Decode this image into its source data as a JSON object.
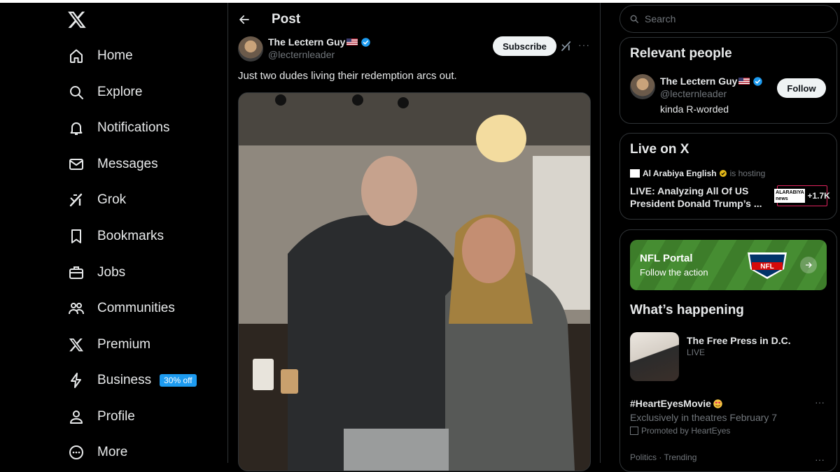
{
  "nav": {
    "items": [
      {
        "label": "Home",
        "icon": "home-icon"
      },
      {
        "label": "Explore",
        "icon": "search-icon"
      },
      {
        "label": "Notifications",
        "icon": "bell-icon"
      },
      {
        "label": "Messages",
        "icon": "envelope-icon"
      },
      {
        "label": "Grok",
        "icon": "grok-icon"
      },
      {
        "label": "Bookmarks",
        "icon": "bookmark-icon"
      },
      {
        "label": "Jobs",
        "icon": "briefcase-icon"
      },
      {
        "label": "Communities",
        "icon": "people-icon"
      },
      {
        "label": "Premium",
        "icon": "x-logo-icon"
      },
      {
        "label": "Business",
        "icon": "lightning-icon",
        "badge": "30% off"
      },
      {
        "label": "Profile",
        "icon": "person-icon"
      },
      {
        "label": "More",
        "icon": "more-circle-icon"
      }
    ]
  },
  "post": {
    "header_title": "Post",
    "author_name": "The Lectern Guy",
    "author_handle": "@lecternleader",
    "subscribe_label": "Subscribe",
    "text": "Just two dudes living their redemption arcs out."
  },
  "search": {
    "placeholder": "Search"
  },
  "relevant_people": {
    "title": "Relevant people",
    "name": "The Lectern Guy",
    "handle": "@lecternleader",
    "bio": "kinda R-worded",
    "follow_label": "Follow"
  },
  "live": {
    "title": "Live on X",
    "host": "Al Arabiya English",
    "hosting_text": "is hosting",
    "stream_title": "LIVE: Analyzing All Of US President Donald Trump’s ...",
    "channel_logo_text": "ALARABIYA news",
    "listeners": "+1.7K"
  },
  "happening": {
    "nfl_title": "NFL Portal",
    "nfl_subtitle": "Follow the action",
    "nfl_logo_text": "NFL",
    "title": "What’s happening",
    "live_event_name": "The Free Press in D.C.",
    "live_event_status": "LIVE",
    "hashtag": "#HeartEyesMovie",
    "hashtag_sub": "Exclusively in theatres February 7",
    "promoted": "Promoted by HeartEyes",
    "category": "Politics · Trending"
  },
  "colors": {
    "accent": "#1d9bf0",
    "background": "#000000",
    "text": "#e7e9ea",
    "muted": "#71767b",
    "border": "#2f3336"
  }
}
